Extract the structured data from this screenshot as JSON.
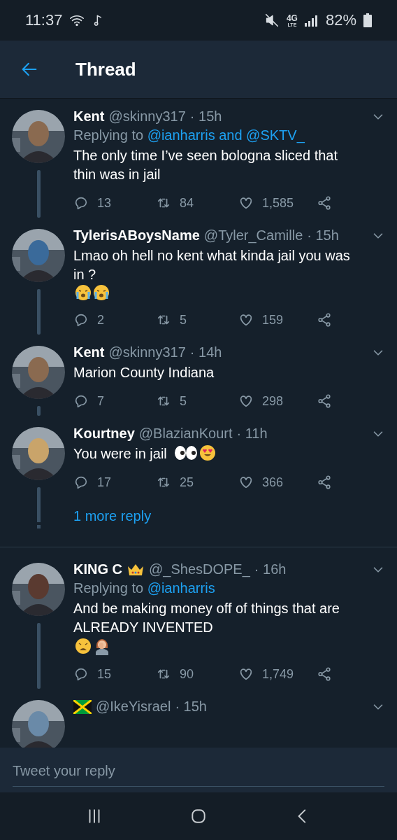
{
  "status_bar": {
    "time": "11:37",
    "network": "4G",
    "network_sub": "LTE",
    "battery": "82%"
  },
  "header": {
    "title": "Thread"
  },
  "tweets": [
    {
      "name": "Kent",
      "handle": "@skinny317",
      "time": "· 15h",
      "replying_label": "Replying to",
      "replying_targets": "@ianharris and @SKTV_",
      "text": "The only time I’ve seen bologna sliced that thin was in jail",
      "replies": "13",
      "retweets": "84",
      "likes": "1,585",
      "connected_below": true
    },
    {
      "name": "TylerisABoysName",
      "handle": "@Tyler_Camille",
      "time": "· 15h",
      "text": "Lmao oh hell no kent what kinda jail you was in ?",
      "emojis": [
        {
          "kind": "crying"
        },
        {
          "kind": "crying"
        }
      ],
      "replies": "2",
      "retweets": "5",
      "likes": "159",
      "connected_below": true
    },
    {
      "name": "Kent",
      "handle": "@skinny317",
      "time": "· 14h",
      "text": "Marion County Indiana",
      "replies": "7",
      "retweets": "5",
      "likes": "298",
      "connected_below": true
    },
    {
      "name": "Kourtney",
      "handle": "@BlazianKourt",
      "time": "· 11h",
      "text": "You were in jail",
      "emojis": [
        {
          "kind": "eyes"
        },
        {
          "kind": "heart_eyes"
        }
      ],
      "replies": "17",
      "retweets": "25",
      "likes": "366",
      "connected_below": true,
      "more_replies": "1 more reply"
    },
    {
      "name": "KING C",
      "badges": [
        {
          "kind": "crown"
        }
      ],
      "handle": "@_ShesDOPE_",
      "time": "· 16h",
      "replying_label": "Replying to",
      "replying_targets": "@ianharris",
      "text": "And be making money off of things that are ALREADY INVENTED",
      "emojis": [
        {
          "kind": "weary"
        },
        {
          "kind": "facepalm"
        }
      ],
      "replies": "15",
      "retweets": "90",
      "likes": "1,749",
      "connected_below": true
    },
    {
      "badges": [
        {
          "kind": "jamaica_flag"
        }
      ],
      "handle": "@IkeYisrael",
      "time": "· 15h"
    }
  ],
  "reply_field": {
    "placeholder": "Tweet your reply"
  }
}
